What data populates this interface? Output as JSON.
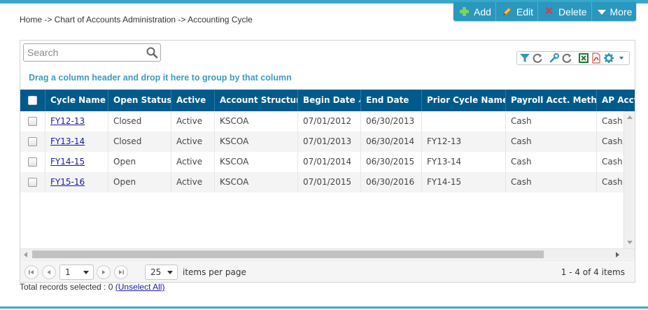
{
  "breadcrumb": "Home -> Chart of Accounts Administration -> Accounting Cycle",
  "actions": {
    "add": "Add",
    "edit": "Edit",
    "delete": "Delete",
    "more": "More"
  },
  "search": {
    "placeholder": "Search",
    "value": ""
  },
  "group_hint": "Drag a column header and drop it here to group by that column",
  "columns": [
    "Cycle Name",
    "Open Status",
    "Active",
    "Account Structure",
    "Begin Date",
    "End Date",
    "Prior Cycle Name",
    "Payroll Acct. Method",
    "AP Acct. Method"
  ],
  "sorted_column": "Begin Date",
  "rows": [
    {
      "cycle_name": "FY12-13",
      "open_status": "Closed",
      "active": "Active",
      "account_structure": "KSCOA",
      "begin_date": "07/01/2012",
      "end_date": "06/30/2013",
      "prior_cycle_name": "",
      "payroll_method": "Cash",
      "ap_method": "Cash"
    },
    {
      "cycle_name": "FY13-14",
      "open_status": "Closed",
      "active": "Active",
      "account_structure": "KSCOA",
      "begin_date": "07/01/2013",
      "end_date": "06/30/2014",
      "prior_cycle_name": "FY12-13",
      "payroll_method": "Cash",
      "ap_method": "Cash"
    },
    {
      "cycle_name": "FY14-15",
      "open_status": "Open",
      "active": "Active",
      "account_structure": "KSCOA",
      "begin_date": "07/01/2014",
      "end_date": "06/30/2015",
      "prior_cycle_name": "FY13-14",
      "payroll_method": "Cash",
      "ap_method": "Cash"
    },
    {
      "cycle_name": "FY15-16",
      "open_status": "Open",
      "active": "Active",
      "account_structure": "KSCOA",
      "begin_date": "07/01/2015",
      "end_date": "06/30/2016",
      "prior_cycle_name": "FY14-15",
      "payroll_method": "Cash",
      "ap_method": "Cash"
    }
  ],
  "pager": {
    "current_page": "1",
    "page_size": "25",
    "page_size_label": "items per page",
    "range_text": "1 - 4 of 4 items"
  },
  "footer": {
    "selected_text": "Total records selected : 0",
    "unselect_label": "(Unselect All)"
  },
  "icons": {
    "toolbar": [
      "filter-icon",
      "refresh-icon",
      "wrench-icon",
      "refresh-icon",
      "excel-icon",
      "pdf-icon",
      "gear-icon",
      "caret-down-icon"
    ]
  },
  "colors": {
    "header_bg": "#005b8c",
    "action_bar_bg": "#2a97bf",
    "accent": "#3aa9c9",
    "link": "#1a1aa8"
  }
}
